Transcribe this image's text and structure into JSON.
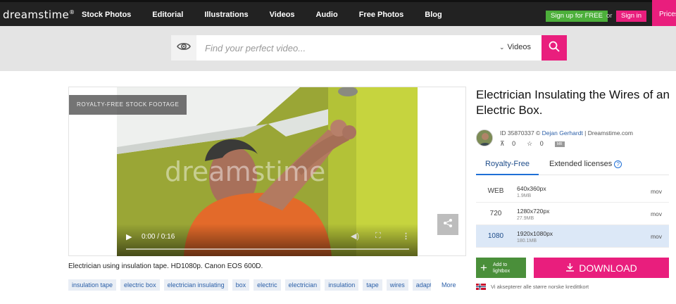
{
  "header": {
    "logo": "dreamstime",
    "logo_mark": "®",
    "nav": [
      "Stock Photos",
      "Editorial",
      "Illustrations",
      "Videos",
      "Audio",
      "Free Photos",
      "Blog"
    ],
    "signup_label": "Sign up for FREE",
    "or_label": "or",
    "signin_label": "Sign in",
    "prices_label": "Prices"
  },
  "search": {
    "placeholder": "Find your perfect video...",
    "value": "",
    "type_selected": "Videos",
    "icons": {
      "visual_search": "eye-icon",
      "submit": "search-icon"
    }
  },
  "player": {
    "badge": "ROYALTY-FREE STOCK FOOTAGE",
    "watermark": "dreamstime",
    "time": "0:00 / 0:16",
    "progress": 0,
    "icons": {
      "play": "play-icon",
      "volume": "volume-icon",
      "fullscreen": "fullscreen-icon",
      "more": "more-vertical-icon",
      "share": "share-icon"
    }
  },
  "caption": "Electrician using insulation tape. HD1080p. Canon EOS 600D.",
  "tags": [
    "insulation tape",
    "electric box",
    "electrician insulating",
    "box",
    "electric",
    "electrician",
    "insulation",
    "tape",
    "wires",
    "adapter"
  ],
  "tags_more": "More",
  "details": {
    "title": "Electrician Insulating the Wires of an Electric Box.",
    "id_prefix": "ID 35870337 © ",
    "author": "Dejan Gerhardt",
    "site": " | Dreamstime.com",
    "views": "0",
    "favorites": "0",
    "mr_badge": "MR"
  },
  "license_tabs": {
    "royalty_free": "Royalty-Free",
    "extended": "Extended licenses",
    "help": "?"
  },
  "sizes": [
    {
      "name": "WEB",
      "dims": "640x360px",
      "size": "1.9MB",
      "format": "mov",
      "selected": false
    },
    {
      "name": "720",
      "dims": "1280x720px",
      "size": "27.9MB",
      "format": "mov",
      "selected": false
    },
    {
      "name": "1080",
      "dims": "1920x1080px",
      "size": "180.1MB",
      "format": "mov",
      "selected": true
    }
  ],
  "actions": {
    "lightbox_line1": "Add to",
    "lightbox_line2": "lightbox",
    "download": "DOWNLOAD"
  },
  "notice": "Vi aksepterer alle større norske kredittkort",
  "colors": {
    "brand_pink": "#e91e7d",
    "signup_green": "#4caf3a",
    "selected_row": "#dce8f7",
    "link_blue": "#2b5fa8"
  }
}
